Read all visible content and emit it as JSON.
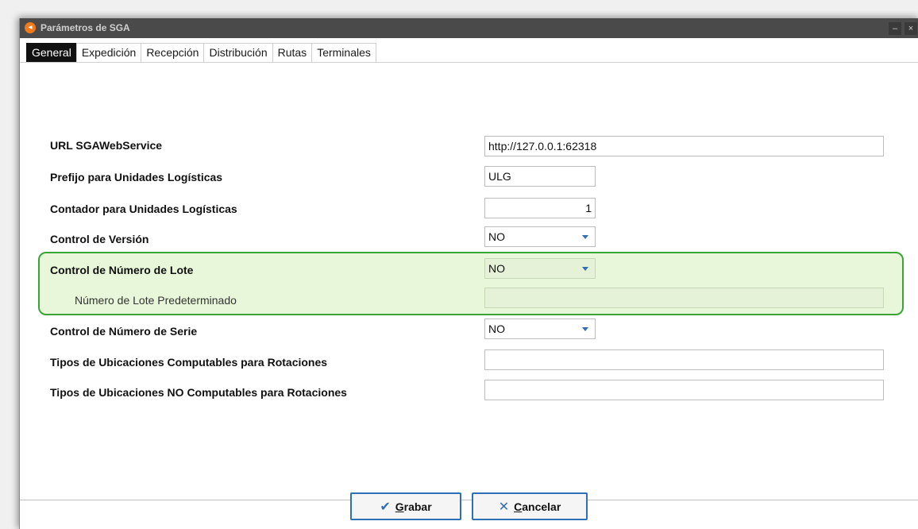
{
  "window": {
    "title": "Parámetros de SGA",
    "app_icon": "app-logo-icon",
    "minimize": "–",
    "close": "×"
  },
  "tabs": [
    {
      "label": "General",
      "active": true
    },
    {
      "label": "Expedición"
    },
    {
      "label": "Recepción"
    },
    {
      "label": "Distribución"
    },
    {
      "label": "Rutas"
    },
    {
      "label": "Terminales"
    }
  ],
  "fields": {
    "url": {
      "label": "URL SGAWebService",
      "value": "http://127.0.0.1:62318"
    },
    "prefix": {
      "label": "Prefijo para Unidades Logísticas",
      "value": "ULG"
    },
    "counter": {
      "label": "Contador para Unidades Logísticas",
      "value": "1"
    },
    "version_control": {
      "label": "Control de Versión",
      "value": "NO"
    },
    "lot_control": {
      "label": "Control de Número de Lote",
      "value": "NO"
    },
    "default_lot": {
      "label": "Número de Lote Predeterminado",
      "value": ""
    },
    "serial_control": {
      "label": "Control de Número de Serie",
      "value": "NO"
    },
    "computable_types": {
      "label": "Tipos de Ubicaciones Computables para Rotaciones",
      "value": ""
    },
    "noncomputable_types": {
      "label": "Tipos de Ubicaciones NO Computables para Rotaciones",
      "value": ""
    }
  },
  "buttons": {
    "save": {
      "first": "G",
      "rest": "rabar",
      "icon": "✔"
    },
    "cancel": {
      "first": "C",
      "rest": "ancelar",
      "icon": "✕"
    }
  },
  "colors": {
    "highlight_border": "#3aa435",
    "highlight_fill": "#e8f7d9",
    "accent": "#2f6fb3"
  }
}
